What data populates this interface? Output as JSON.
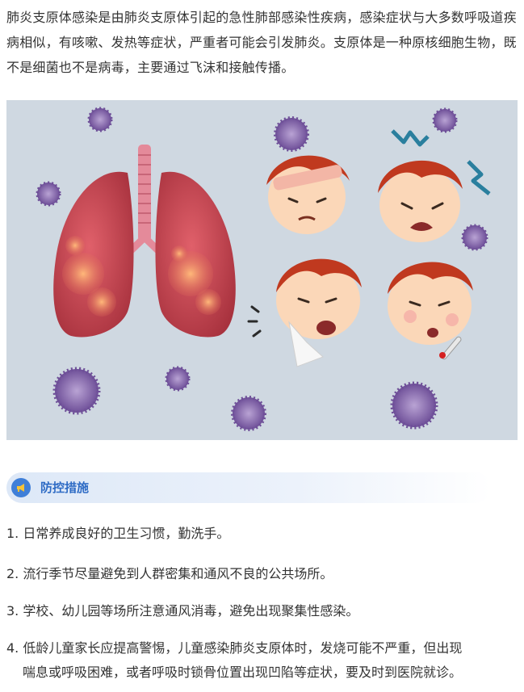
{
  "intro": {
    "paragraph": "肺炎支原体感染是由肺炎支原体引起的急性肺部感染性疾病，感染症状与大多数呼吸道疾病相似，有咳嗽、发热等症状，严重者可能会引发肺炎。支原体是一种原核细胞生物，既不是细菌也不是病毒，主要通过飞沫和接触传播。"
  },
  "illustration": {
    "background": "#cfd8e1",
    "lung_color": "#c8404a",
    "virus_color": "#7a5aa0",
    "hair_color": "#c0391f"
  },
  "section": {
    "icon": "megaphone-icon",
    "title": "防控措施",
    "accent": "#3f7fd8"
  },
  "measures": [
    {
      "num": "1.",
      "text": "日常养成良好的卫生习惯，勤洗手。"
    },
    {
      "num": "2.",
      "text": "流行季节尽量避免到人群密集和通风不良的公共场所。"
    },
    {
      "num": "3.",
      "text": "学校、幼儿园等场所注意通风消毒，避免出现聚集性感染。"
    },
    {
      "num": "4.",
      "text": "低龄儿童家长应提高警惕，儿童感染肺炎支原体时，发烧可能不严重，但出现",
      "cont": "喘息或呼吸困难，或者呼吸时锁骨位置出现凹陷等症状，要及时到医院就诊。"
    }
  ]
}
